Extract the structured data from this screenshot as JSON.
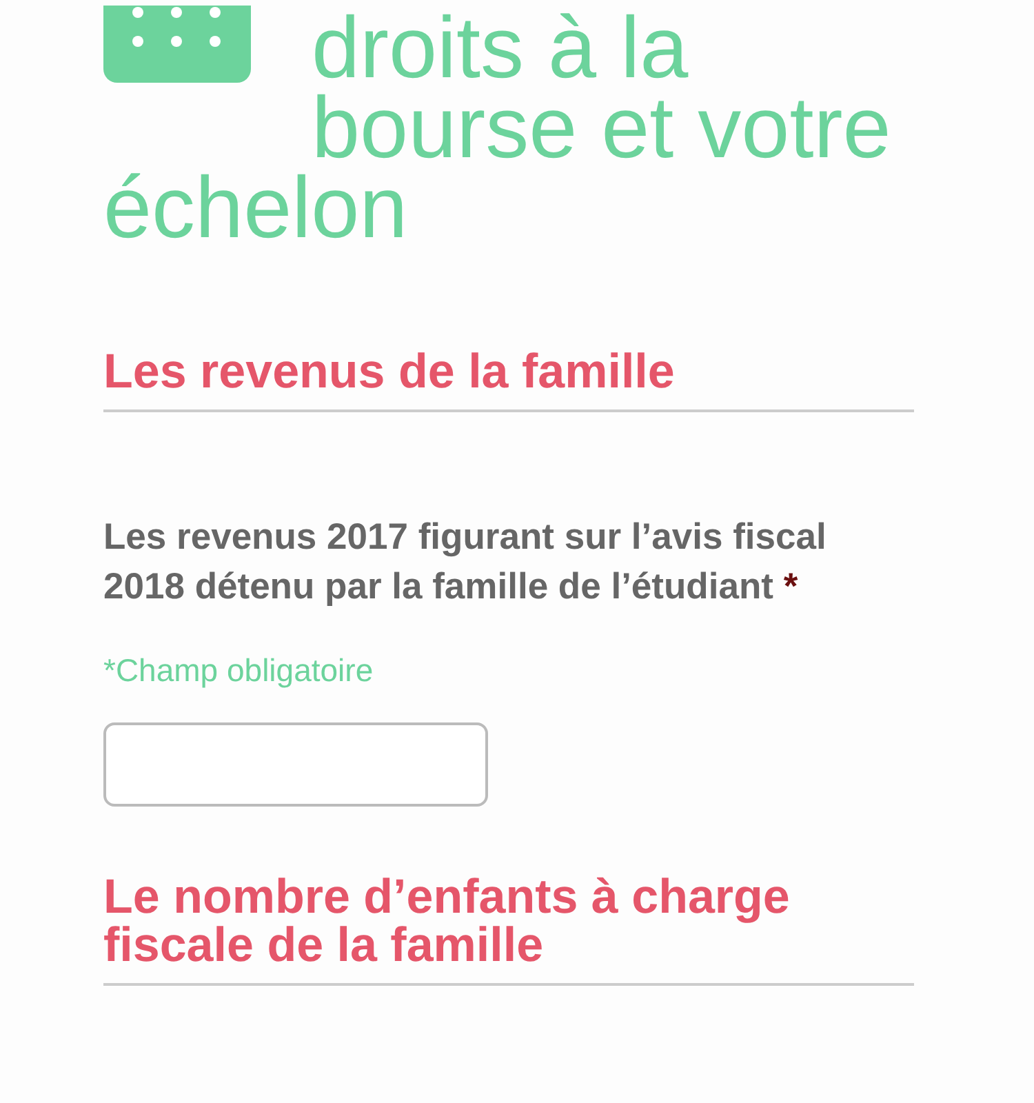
{
  "title_lines": [
    "droits à la",
    "bourse et votre",
    "échelon"
  ],
  "sections": [
    {
      "heading": "Les revenus de la famille",
      "fields": [
        {
          "label": "Les revenus 2017 figurant sur l’avis fiscal 2018 détenu par la famille de l’étudiant",
          "required_mark": "*",
          "hint": "*Champ obligatoire"
        }
      ]
    },
    {
      "heading": "Le nombre d’enfants à charge fiscale de la famille"
    }
  ]
}
